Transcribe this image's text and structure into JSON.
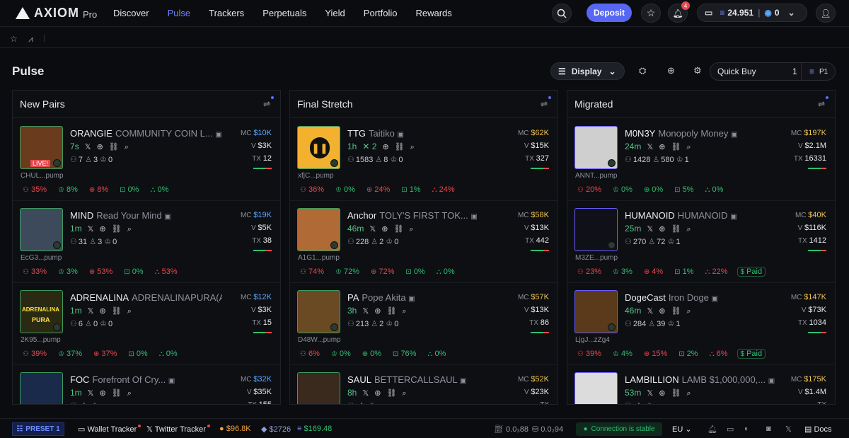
{
  "app": {
    "brand": "AXIOM",
    "brand_suffix": "Pro"
  },
  "nav": [
    "Discover",
    "Pulse",
    "Trackers",
    "Perpetuals",
    "Yield",
    "Portfolio",
    "Rewards"
  ],
  "header": {
    "deposit_label": "Deposit",
    "notif_count": "4",
    "sol_balance": "24.951",
    "other_balance": "0"
  },
  "page": {
    "title": "Pulse",
    "display_label": "Display",
    "quick_buy_label": "Quick Buy",
    "quick_buy_value": "1",
    "preset_label": "P1"
  },
  "columns": [
    {
      "title": "New Pairs",
      "cards": [
        {
          "ticker": "ORANGIE",
          "name": "COMMUNITY COIN L...",
          "age": "7s",
          "addr": "CHUL...pump",
          "holders": "7",
          "pro": "3",
          "extra": "0",
          "mc": "$10K",
          "vol": "$3K",
          "tx": "12",
          "live": "LIVE!",
          "pills": [
            "35%",
            "8%",
            "8%",
            "0%",
            "0%"
          ]
        },
        {
          "ticker": "MIND",
          "name": "Read Your Mind",
          "age": "1m",
          "addr": "EcG3...pump",
          "holders": "31",
          "pro": "3",
          "extra": "0",
          "mc": "$19K",
          "vol": "$5K",
          "tx": "38",
          "pills": [
            "33%",
            "3%",
            "53%",
            "0%",
            "53%"
          ]
        },
        {
          "ticker": "ADRENALINA",
          "name": "ADRENALINAPURA(A...",
          "age": "1m",
          "addr": "2K95...pump",
          "holders": "6",
          "pro": "0",
          "extra": "0",
          "mc": "$12K",
          "vol": "$3K",
          "tx": "15",
          "avatar_text_1": "ADRENALINA",
          "avatar_text_2": "PURA",
          "pills": [
            "39%",
            "37%",
            "37%",
            "0%",
            "0%"
          ]
        },
        {
          "ticker": "FOC",
          "name": "Forefront Of Cry...",
          "age": "1m",
          "addr": "",
          "holders": "",
          "pro": "",
          "extra": "",
          "mc": "$32K",
          "vol": "$35K",
          "tx": "155",
          "pills": []
        }
      ]
    },
    {
      "title": "Final Stretch",
      "cards": [
        {
          "ticker": "TTG",
          "name": "Taitiko",
          "age": "1h",
          "x_count": "2",
          "addr": "xfjC...pump",
          "holders": "1583",
          "pro": "8",
          "extra": "0",
          "mc": "$62K",
          "vol": "$15K",
          "tx": "327",
          "pills": [
            "36%",
            "0%",
            "24%",
            "1%",
            "24%"
          ]
        },
        {
          "ticker": "Anchor",
          "name": "TOLY'S FIRST TOK...",
          "age": "46m",
          "addr": "A1G1...pump",
          "holders": "228",
          "pro": "2",
          "extra": "0",
          "mc": "$58K",
          "vol": "$13K",
          "tx": "442",
          "pills": [
            "74%",
            "72%",
            "72%",
            "0%",
            "0%"
          ]
        },
        {
          "ticker": "PA",
          "name": "Pope Akita",
          "age": "3h",
          "addr": "D48W...pump",
          "holders": "213",
          "pro": "2",
          "extra": "0",
          "mc": "$57K",
          "vol": "$13K",
          "tx": "86",
          "pills": [
            "6%",
            "0%",
            "0%",
            "76%",
            "0%"
          ]
        },
        {
          "ticker": "SAUL",
          "name": "BETTERCALLSAUL",
          "age": "8h",
          "addr": "",
          "holders": "",
          "pro": "",
          "extra": "",
          "mc": "$52K",
          "vol": "$23K",
          "tx": "",
          "pills": []
        }
      ]
    },
    {
      "title": "Migrated",
      "cards": [
        {
          "ticker": "M0N3Y",
          "name": "Monopoly Money",
          "age": "24m",
          "addr": "ANNT...pump",
          "holders": "1428",
          "pro": "580",
          "extra": "1",
          "mc": "$197K",
          "vol": "$2.1M",
          "tx": "16331",
          "pills": [
            "20%",
            "0%",
            "0%",
            "5%",
            "0%"
          ]
        },
        {
          "ticker": "HUMANOID",
          "name": "HUMANOID",
          "age": "25m",
          "addr": "M3ZE...pump",
          "holders": "270",
          "pro": "72",
          "extra": "1",
          "mc": "$40K",
          "vol": "$116K",
          "tx": "1412",
          "pills": [
            "23%",
            "3%",
            "4%",
            "1%",
            "22%",
            "Paid"
          ]
        },
        {
          "ticker": "DogeCast",
          "name": "Iron Doge",
          "age": "46m",
          "addr": "LjgJ...zZg4",
          "holders": "284",
          "pro": "39",
          "extra": "1",
          "mc": "$147K",
          "vol": "$73K",
          "tx": "1034",
          "pills": [
            "39%",
            "4%",
            "15%",
            "2%",
            "6%",
            "Paid"
          ]
        },
        {
          "ticker": "LAMBILLION",
          "name": "LAMB $1,000,000,...",
          "age": "53m",
          "addr": "",
          "holders": "",
          "pro": "",
          "extra": "",
          "mc": "$175K",
          "vol": "$1.4M",
          "tx": "",
          "pills": []
        }
      ]
    }
  ],
  "labels": {
    "mc": "MC",
    "v": "V",
    "tx": "TX"
  },
  "footer": {
    "preset": "PRESET 1",
    "wallet_tracker": "Wallet Tracker",
    "twitter_tracker": "Twitter Tracker",
    "btc": "$96.8K",
    "eth": "$2726",
    "sol": "$169.48",
    "fee1": "0.0₃88",
    "fee2": "0.0₂94",
    "connection": "Connection is stable",
    "region": "EU",
    "docs": "Docs"
  }
}
